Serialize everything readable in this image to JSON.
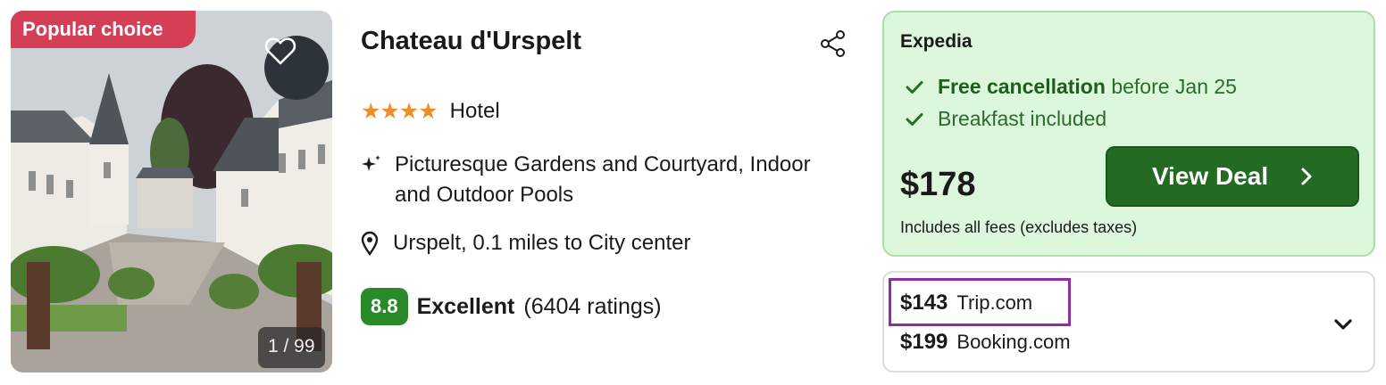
{
  "listing": {
    "badge": "Popular choice",
    "photo_counter": "1 / 99",
    "name": "Chateau d'Urspelt",
    "star_rating": 4,
    "stars_text": "★★★★",
    "property_type": "Hotel",
    "amenities": "Picturesque Gardens and Courtyard, Indoor and Outdoor Pools",
    "location": "Urspelt, 0.1 miles to City center",
    "review": {
      "score": "8.8",
      "label": "Excellent",
      "count": "(6404 ratings)"
    }
  },
  "deal": {
    "provider": "Expedia",
    "perk1_bold": "Free cancellation",
    "perk1_rest": "before Jan 25",
    "perk2": "Breakfast included",
    "price": "$178",
    "fee_note": "Includes all fees (excludes taxes)",
    "cta": "View Deal"
  },
  "other_offers": [
    {
      "price": "$143",
      "site": "Trip.com"
    },
    {
      "price": "$199",
      "site": "Booking.com"
    }
  ],
  "colors": {
    "badge": "#d43f56",
    "stars": "#f08d2b",
    "score": "#2a8a2a",
    "deal_bg": "#dcf7dc",
    "cta": "#236b23",
    "highlight": "#8b2fa3"
  },
  "icons": [
    "heart-icon",
    "share-icon",
    "sparkle-icon",
    "location-pin-icon",
    "checkmark-icon",
    "chevron-right-icon",
    "chevron-down-icon"
  ]
}
